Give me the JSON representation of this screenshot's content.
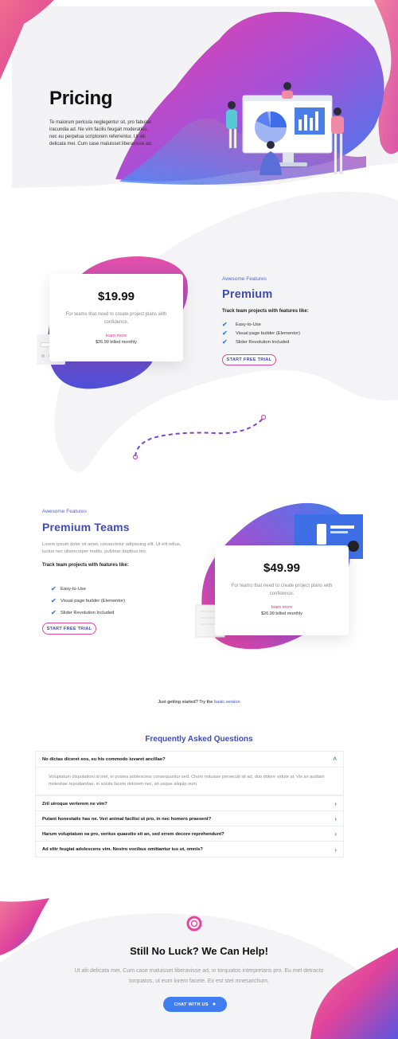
{
  "hero": {
    "title": "Pricing",
    "text": "Te maiorum pericula neglegentur sit, pro fabulas iracundia ad. Ne vim facilis feugait moderatius, nec eu perpetua scriptorem referrentur. Ut alii delicata mei. Cum case maluisset liberavisse ad."
  },
  "premium": {
    "card": {
      "price": "$19.99",
      "desc": "For teams that need to create project plans with confidence.",
      "link": "learn more",
      "billed": "$26.99 billed monthly"
    },
    "eyebrow": "Awesome Features",
    "heading": "Premium",
    "sub": "Track team projects with features like:",
    "features": [
      "Easy-to-Use",
      "Visual page builder (Elementor)",
      "Slider Revolution Included"
    ],
    "button": "START FREE TRIAL"
  },
  "teams": {
    "eyebrow": "Awesome Features",
    "heading": "Premium Teams",
    "para": "Lorem ipsum dolor sit amet, consectetur adipiscing elit. Ut elit tellus, luctus nec ullamcorper mattis, pulvinar dapibus leo.",
    "sub": "Track team projects with features like:",
    "features": [
      "Easy-to-Use",
      "Visual page builder (Elementor)",
      "Slider Revolution Included"
    ],
    "button": "START FREE TRIAL",
    "card": {
      "price": "$49.99",
      "desc": "For teams that need to create project plans with confidence.",
      "link": "learn more",
      "billed": "$26.99 billed monthly"
    }
  },
  "basic": {
    "text": "Just getting started? Try the ",
    "link": "basic version"
  },
  "faq": {
    "title": "Frequently Asked Questions",
    "open": {
      "question": "No dictas diceret eos, eu his commodo iuvaret ancillae?",
      "answer": "Voluptatum disputationi id mel, ei postea adolescens consequuntur sed. Choro noluisse persecuti sit ad, duo dolore virtute at. Vix an audiam molestiae repudiandae, in soluta facete dolorem nec, an usque aliquip eum."
    },
    "items": [
      "Zril utroque verterem ne vim?",
      "Putant honestatis has ne. Veri animal facilisi ut pro, in nec homero praesent?",
      "Harum voluptatum ea pro, veritus quaestio sit an, sed errem decore reprehendunt?",
      "Ad elitr feugiat adolescens vim. Nostro vocibus omittantur ius ut, omnis?"
    ]
  },
  "cta": {
    "title": "Still No Luck? We Can Help!",
    "text": "Ut alii delicata mei. Cum case maluisset liberavisse ad, in torquatos interpretaris pro. Eu mel detracto torquatos, ut eum lorem facete. Ex est stet mnesarchum.",
    "button": "CHAT WITH US"
  },
  "colors": {
    "accent_blue": "#3f4bb4",
    "pink": "#e0439b",
    "button_blue": "#3f7df0"
  }
}
